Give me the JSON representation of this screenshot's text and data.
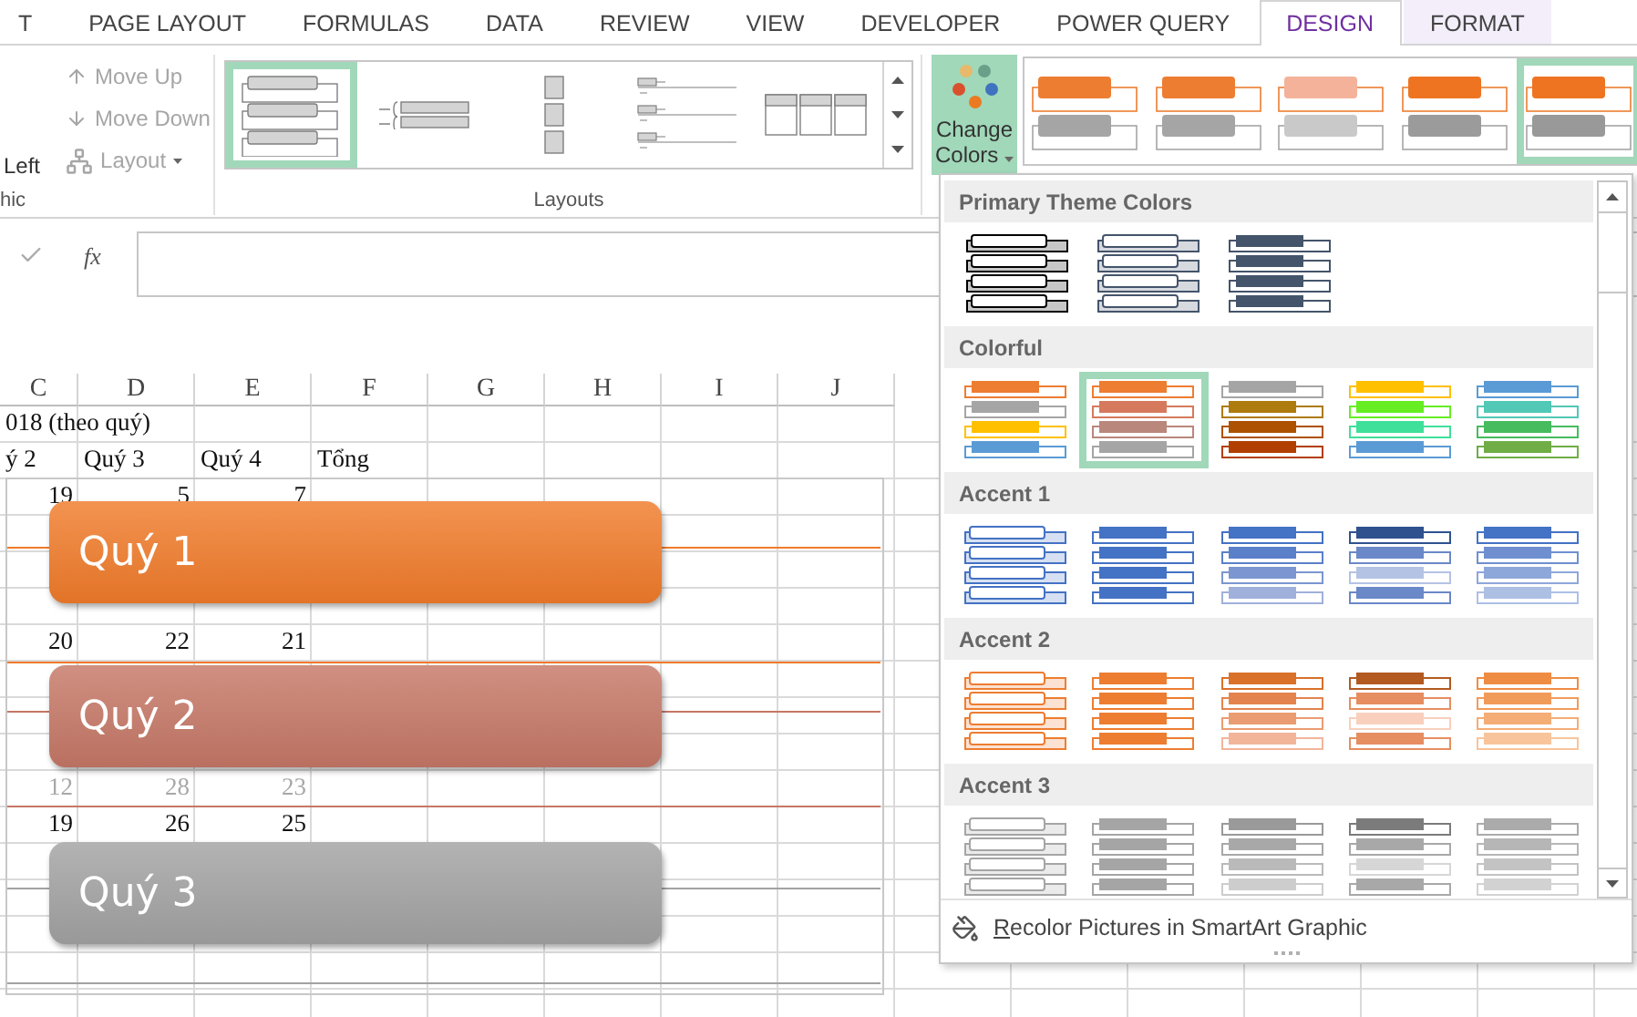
{
  "tabs": [
    {
      "label": "T",
      "selected": false,
      "kind": "standard"
    },
    {
      "label": "PAGE LAYOUT",
      "selected": false,
      "kind": "standard"
    },
    {
      "label": "FORMULAS",
      "selected": false,
      "kind": "standard"
    },
    {
      "label": "DATA",
      "selected": false,
      "kind": "standard"
    },
    {
      "label": "REVIEW",
      "selected": false,
      "kind": "standard"
    },
    {
      "label": "VIEW",
      "selected": false,
      "kind": "standard"
    },
    {
      "label": "DEVELOPER",
      "selected": false,
      "kind": "standard"
    },
    {
      "label": "POWER QUERY",
      "selected": false,
      "kind": "standard"
    },
    {
      "label": "DESIGN",
      "selected": true,
      "kind": "contextual"
    },
    {
      "label": "FORMAT",
      "selected": false,
      "kind": "contextual"
    }
  ],
  "ribbon": {
    "create_group": {
      "label": "hic",
      "left_column": {
        "label": "Left",
        "disabled": false
      },
      "commands": [
        {
          "label": "Move Up",
          "kind": "up",
          "disabled": true
        },
        {
          "label": "Move Down",
          "kind": "down",
          "disabled": true
        },
        {
          "label": "Layout",
          "kind": "layout",
          "disabled": true
        }
      ]
    },
    "layouts": {
      "label": "Layouts",
      "items": [
        {
          "kind": "box-list",
          "selected": true
        },
        {
          "kind": "bracket-list",
          "selected": false
        },
        {
          "kind": "block-list",
          "selected": false
        },
        {
          "kind": "line-list",
          "selected": false
        },
        {
          "kind": "table-list",
          "selected": false
        }
      ]
    },
    "change_colors": {
      "label": "Change Colors",
      "expanded": true
    },
    "styles": [
      {
        "selected": false,
        "rows": [
          {
            "color": "#ed7d31"
          },
          {
            "color": "#a5a5a5"
          }
        ]
      },
      {
        "selected": false,
        "rows": [
          {
            "color": "#ed7d31"
          },
          {
            "color": "#a5a5a5"
          }
        ]
      },
      {
        "selected": false,
        "rows": [
          {
            "color": "#f4b29a"
          },
          {
            "color": "#c9c9c9"
          }
        ]
      },
      {
        "selected": false,
        "rows": [
          {
            "color": "#ee7422"
          },
          {
            "color": "#9b9b9b"
          }
        ]
      },
      {
        "selected": true,
        "rows": [
          {
            "color": "#ee7422"
          },
          {
            "color": "#999999"
          }
        ]
      }
    ]
  },
  "formula_bar": {
    "function_label": "fx"
  },
  "sheet": {
    "columns": [
      "C",
      "D",
      "E",
      "F",
      "G",
      "H",
      "I",
      "J"
    ],
    "rows": [
      {
        "kind": "title",
        "text": "018 (theo quý)"
      },
      {
        "kind": "labels",
        "cells": [
          "ý 2",
          "Quý 3",
          "Quý 4",
          "Tổng"
        ]
      },
      {
        "kind": "values",
        "faded": false,
        "cells": [
          "19",
          "5",
          "7"
        ]
      },
      {
        "kind": "blank"
      },
      {
        "kind": "blank"
      },
      {
        "kind": "blank"
      },
      {
        "kind": "values",
        "faded": false,
        "cells": [
          "20",
          "22",
          "21"
        ]
      },
      {
        "kind": "blank"
      },
      {
        "kind": "blank"
      },
      {
        "kind": "blank"
      },
      {
        "kind": "values",
        "faded": true,
        "cells": [
          "12",
          "28",
          "23"
        ]
      },
      {
        "kind": "values",
        "faded": false,
        "cells": [
          "19",
          "26",
          "25"
        ]
      },
      {
        "kind": "blank"
      },
      {
        "kind": "blank"
      },
      {
        "kind": "blank"
      },
      {
        "kind": "blank"
      },
      {
        "kind": "blank"
      }
    ]
  },
  "smartart": {
    "items": [
      {
        "text": "Quý 1",
        "color": "#f07b2a"
      },
      {
        "text": "Quý 2",
        "color": "#c57766"
      },
      {
        "text": "Quý 3",
        "color": "#a2a2a2"
      }
    ]
  },
  "colors_menu": {
    "sections": [
      {
        "title": "Primary Theme Colors",
        "options": [
          {
            "kind": "outline",
            "selected": false,
            "rows": [
              {
                "color": "#000000"
              },
              {
                "color": "#000000"
              },
              {
                "color": "#000000"
              },
              {
                "color": "#000000"
              }
            ]
          },
          {
            "kind": "outline",
            "selected": false,
            "rows": [
              {
                "color": "#44546a"
              },
              {
                "color": "#44546a"
              },
              {
                "color": "#44546a"
              },
              {
                "color": "#44546a"
              }
            ]
          },
          {
            "kind": "filled",
            "selected": false,
            "rows": [
              {
                "color": "#44546a"
              },
              {
                "color": "#44546a"
              },
              {
                "color": "#44546a"
              },
              {
                "color": "#44546a"
              }
            ]
          }
        ]
      },
      {
        "title": "Colorful",
        "options": [
          {
            "kind": "filled",
            "selected": false,
            "rows": [
              {
                "color": "#ed7d31"
              },
              {
                "color": "#a5a5a5"
              },
              {
                "color": "#ffc000"
              },
              {
                "color": "#5b9bd5"
              }
            ]
          },
          {
            "kind": "filled",
            "selected": true,
            "rows": [
              {
                "color": "#ed7d31"
              },
              {
                "color": "#d57a5c"
              },
              {
                "color": "#b9877c"
              },
              {
                "color": "#a5a5a5"
              }
            ]
          },
          {
            "kind": "filled",
            "selected": false,
            "rows": [
              {
                "color": "#a5a5a5"
              },
              {
                "color": "#ae7b0e"
              },
              {
                "color": "#ad5200"
              },
              {
                "color": "#b13f00"
              }
            ]
          },
          {
            "kind": "filled",
            "selected": false,
            "rows": [
              {
                "color": "#ffc000"
              },
              {
                "color": "#66ee22"
              },
              {
                "color": "#3fe099"
              },
              {
                "color": "#5b9bd5"
              }
            ]
          },
          {
            "kind": "filled",
            "selected": false,
            "rows": [
              {
                "color": "#5b9bd5"
              },
              {
                "color": "#52c8b6"
              },
              {
                "color": "#46bc5e"
              },
              {
                "color": "#70ad47"
              }
            ]
          }
        ]
      },
      {
        "title": "Accent 1",
        "options": [
          {
            "kind": "outline",
            "selected": false,
            "rows": [
              {
                "color": "#4472c4"
              },
              {
                "color": "#4472c4"
              },
              {
                "color": "#4472c4"
              },
              {
                "color": "#4472c4"
              }
            ]
          },
          {
            "kind": "filled",
            "selected": false,
            "rows": [
              {
                "color": "#4472c4"
              },
              {
                "color": "#4472c4"
              },
              {
                "color": "#4472c4"
              },
              {
                "color": "#4472c4"
              }
            ]
          },
          {
            "kind": "filled",
            "selected": false,
            "rows": [
              {
                "color": "#4472c4"
              },
              {
                "color": "#5a80c9"
              },
              {
                "color": "#7b96d0"
              },
              {
                "color": "#9fb0da"
              }
            ]
          },
          {
            "kind": "filled",
            "selected": false,
            "rows": [
              {
                "color": "#2f528f"
              },
              {
                "color": "#6b88c8"
              },
              {
                "color": "#b4c2e4"
              },
              {
                "color": "#6b88c8"
              }
            ]
          },
          {
            "kind": "filled",
            "selected": false,
            "rows": [
              {
                "color": "#4472c4"
              },
              {
                "color": "#6f8fd0"
              },
              {
                "color": "#8ea7da"
              },
              {
                "color": "#adc0e4"
              }
            ]
          }
        ]
      },
      {
        "title": "Accent 2",
        "options": [
          {
            "kind": "outline",
            "selected": false,
            "rows": [
              {
                "color": "#ed7d31"
              },
              {
                "color": "#ed7d31"
              },
              {
                "color": "#ed7d31"
              },
              {
                "color": "#ed7d31"
              }
            ]
          },
          {
            "kind": "filled",
            "selected": false,
            "rows": [
              {
                "color": "#ed7d31"
              },
              {
                "color": "#ed7d31"
              },
              {
                "color": "#ed7d31"
              },
              {
                "color": "#ed7d31"
              }
            ]
          },
          {
            "kind": "filled",
            "selected": false,
            "rows": [
              {
                "color": "#d9712a"
              },
              {
                "color": "#e3844f"
              },
              {
                "color": "#ea9c72"
              },
              {
                "color": "#f2b59a"
              }
            ]
          },
          {
            "kind": "filled",
            "selected": false,
            "rows": [
              {
                "color": "#b35a22"
              },
              {
                "color": "#e68e61"
              },
              {
                "color": "#f8d0bd"
              },
              {
                "color": "#e68e61"
              }
            ]
          },
          {
            "kind": "filled",
            "selected": false,
            "rows": [
              {
                "color": "#ef8c44"
              },
              {
                "color": "#f19b5b"
              },
              {
                "color": "#f4ad77"
              },
              {
                "color": "#f8c49c"
              }
            ]
          }
        ]
      },
      {
        "title": "Accent 3",
        "options": [
          {
            "kind": "outline",
            "selected": false,
            "rows": [
              {
                "color": "#a5a5a5"
              },
              {
                "color": "#a5a5a5"
              },
              {
                "color": "#a5a5a5"
              },
              {
                "color": "#a5a5a5"
              }
            ]
          },
          {
            "kind": "filled",
            "selected": false,
            "rows": [
              {
                "color": "#a5a5a5"
              },
              {
                "color": "#a5a5a5"
              },
              {
                "color": "#a5a5a5"
              },
              {
                "color": "#a5a5a5"
              }
            ]
          },
          {
            "kind": "filled",
            "selected": false,
            "rows": [
              {
                "color": "#9a9a9a"
              },
              {
                "color": "#a8a8a8"
              },
              {
                "color": "#bababa"
              },
              {
                "color": "#cdcdcd"
              }
            ]
          },
          {
            "kind": "filled",
            "selected": false,
            "rows": [
              {
                "color": "#7b7b7b"
              },
              {
                "color": "#a8a8a8"
              },
              {
                "color": "#d6d6d6"
              },
              {
                "color": "#a8a8a8"
              }
            ]
          },
          {
            "kind": "filled",
            "selected": false,
            "rows": [
              {
                "color": "#ababab"
              },
              {
                "color": "#b6b6b6"
              },
              {
                "color": "#c3c3c3"
              },
              {
                "color": "#d2d2d2"
              }
            ]
          }
        ]
      }
    ],
    "footer": "Recolor Pictures in SmartArt Graphic"
  }
}
